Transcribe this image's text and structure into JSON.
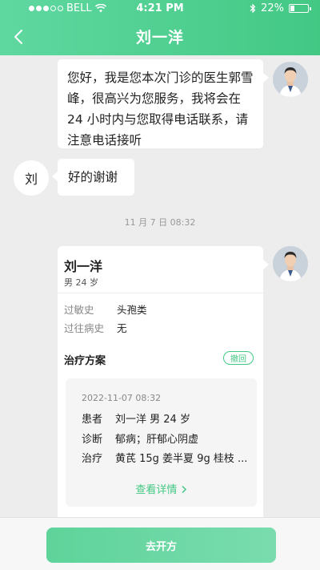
{
  "status_bar": {
    "carrier": "BELL",
    "time": "4:21 PM",
    "battery_percent": "22%",
    "battery_level": 0.22,
    "signal_filled_dots": 3,
    "signal_total_dots": 5
  },
  "header": {
    "title": "刘一洋",
    "back_icon": "chevron-left-icon",
    "background": "#4fd08f"
  },
  "messages": [
    {
      "side": "doctor",
      "text": "您好，我是您本次门诊的医生郭雪峰，很高兴为您服务，我将会在 24 小时内与您取得电话联系，请注意电话接听"
    },
    {
      "side": "patient",
      "avatar_text": "刘",
      "text": "好的谢谢"
    }
  ],
  "timestamp": "11 月 7 日  08:32",
  "card": {
    "patient_name": "刘一洋",
    "patient_sub": "男  24 岁",
    "allergy_label": "过敏史",
    "allergy_value": "头孢类",
    "history_label": "过往病史",
    "history_value": "无",
    "plan_title": "治疗方案",
    "revoke_label": "撤回",
    "plan": {
      "datetime": "2022-11-07 08:32",
      "rows": [
        {
          "label": "患者",
          "value": "刘一洋  男  24 岁"
        },
        {
          "label": "诊断",
          "value": "郁病；肝郁心阴虚"
        },
        {
          "label": "治疗",
          "value": "黄芪 15g 姜半夏 9g 桂枝 ..."
        }
      ],
      "detail_label": "查看详情",
      "detail_icon": "chevron-right-icon"
    }
  },
  "bottom": {
    "button_label": "去开方"
  },
  "colors": {
    "accent": "#43c884",
    "background": "#ededed"
  }
}
